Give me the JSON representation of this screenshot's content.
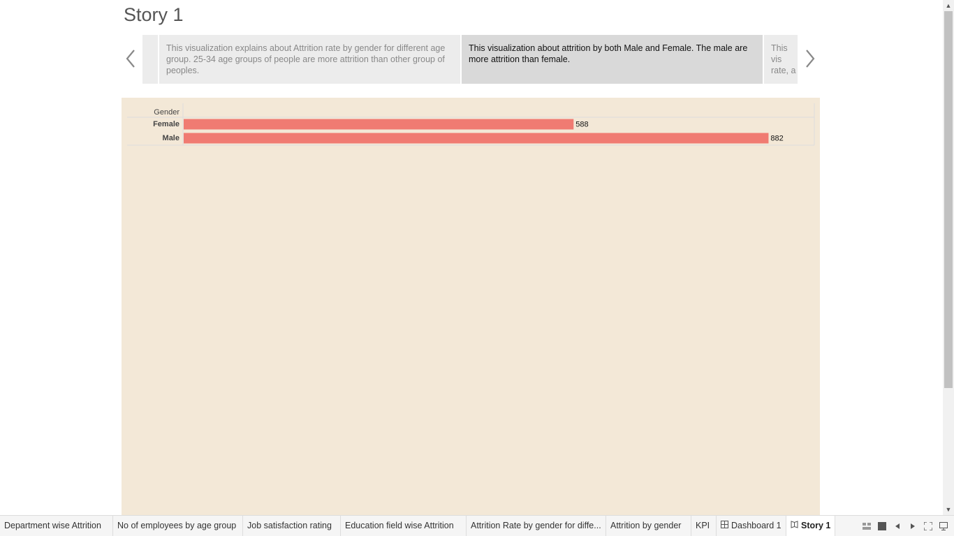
{
  "story": {
    "title": "Story 1"
  },
  "story_points": [
    {
      "text": "This visualization explains about Attrition rate by gender for different age group. 25-34 age groups of people are more attrition than other group of peoples.",
      "active": false
    },
    {
      "text": "This visualization about attrition by both Male and Female. The male are more attrition than female.",
      "active": true
    },
    {
      "text": "This vis rate, a",
      "active": false
    }
  ],
  "chart_data": {
    "type": "bar",
    "orientation": "horizontal",
    "row_header": "Gender",
    "categories": [
      "Female",
      "Male"
    ],
    "values": [
      588,
      882
    ],
    "data_labels": [
      "588",
      "882"
    ],
    "bar_color": "#f07b72",
    "background": "#f3e8d7",
    "xlim": [
      0,
      950
    ],
    "grid": false
  },
  "tabs": [
    {
      "label": "Department wise Attrition",
      "icon": "",
      "active": false
    },
    {
      "label": "No of employees by age group",
      "icon": "",
      "active": false
    },
    {
      "label": "Job satisfaction rating",
      "icon": "",
      "active": false
    },
    {
      "label": "Education field wise Attrition",
      "icon": "",
      "active": false
    },
    {
      "label": "Attrition Rate by gender for diffe...",
      "icon": "",
      "active": false
    },
    {
      "label": "Attrition by gender",
      "icon": "",
      "active": false
    },
    {
      "label": "KPI",
      "icon": "",
      "active": false
    },
    {
      "label": "Dashboard 1",
      "icon": "dashboard-icon",
      "active": false
    },
    {
      "label": "Story 1",
      "icon": "story-icon",
      "active": true
    }
  ],
  "controls": {
    "left_icon": "sheet-sorter-icon",
    "filmstrip_icon": "filmstrip-icon",
    "prev_icon": "previous-sheet-icon",
    "next_icon": "next-sheet-icon",
    "fullscreen_icon": "fullscreen-icon",
    "present_icon": "presentation-mode-icon"
  },
  "scrollbar": {
    "up_icon": "scroll-up-icon",
    "down_icon": "scroll-down-icon"
  }
}
